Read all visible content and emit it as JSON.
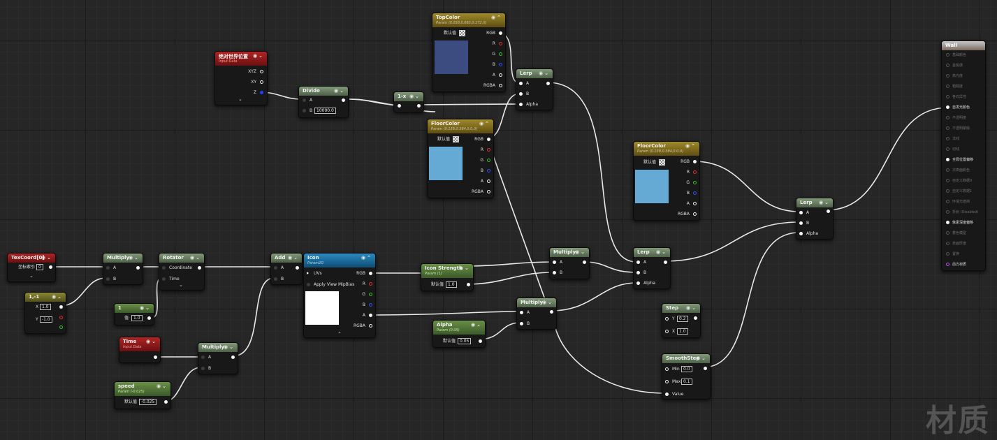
{
  "labels": {
    "default": "默认值",
    "rgb": "RGB",
    "r": "R",
    "g": "G",
    "b": "B",
    "a": "A",
    "rgba": "RGBA",
    "xyz": "XYZ",
    "xy": "XY",
    "z": "Z",
    "alpha": "Alpha",
    "value": "Value",
    "time": "Time",
    "coordinate": "Coordinate",
    "uvs": "UVs",
    "apply_mips": "Apply View MipBias",
    "coord_index": "坐标索引",
    "val": "值",
    "x": "X",
    "y": "Y",
    "min": "Min",
    "max": "Max"
  },
  "nodes": {
    "topcolor": {
      "title": "TopColor",
      "subtitle": "Param (0.038,0.063,0.172,0)"
    },
    "floorcolor1": {
      "title": "FloorColor",
      "subtitle": "Param (0.138,0.384,0.0,0)"
    },
    "floorcolor2": {
      "title": "FloorColor",
      "subtitle": "Param (0.138,0.384,0.0,0)"
    },
    "worldpos": {
      "title": "绝对世界位置",
      "subtitle": "Input Data"
    },
    "divide": {
      "title": "Divide",
      "b_value": "10000.0"
    },
    "oneminus": {
      "title": "1-x"
    },
    "lerp_top": {
      "title": "Lerp"
    },
    "lerp_mid": {
      "title": "Lerp"
    },
    "lerp_right": {
      "title": "Lerp"
    },
    "texcoord": {
      "title": "TexCoord[0]",
      "index_value": "0"
    },
    "vec2": {
      "title": "1,-1",
      "x_value": "1.0",
      "y_value": "-1.0"
    },
    "multiply1": {
      "title": "Multiply"
    },
    "rotator": {
      "title": "Rotator"
    },
    "const1": {
      "title": "1",
      "value": "1.0"
    },
    "add": {
      "title": "Add"
    },
    "time": {
      "title": "Time",
      "subtitle": "Input Data"
    },
    "multiply2": {
      "title": "Multiply"
    },
    "speed": {
      "title": "speed",
      "subtitle": "Param (-0.025)",
      "value": "-0.025"
    },
    "icon": {
      "title": "Icon",
      "subtitle": "Param2D"
    },
    "iconstrength": {
      "title": "Icon Strength",
      "subtitle": "Param (1)",
      "value": "1.0"
    },
    "multiply3": {
      "title": "Multiply"
    },
    "multiply4": {
      "title": "Multiply"
    },
    "alphaparam": {
      "title": "Alpha",
      "subtitle": "Param (0.05)",
      "value": "0.05"
    },
    "step": {
      "title": "Step",
      "y_value": "0.2",
      "x_value": "1.0"
    },
    "smoothstep": {
      "title": "SmoothStep",
      "min_value": "0.0",
      "max_value": "0.1"
    },
    "material": {
      "title": "Wall",
      "pins": [
        "基础颜色",
        "金属感",
        "高光度",
        "粗糙度",
        "各向异性",
        "自发光颜色",
        "不透明度",
        "不透明蒙版",
        "法线",
        "切线",
        "全局位置偏移",
        "次表面颜色",
        "自定义数据0",
        "自定义数据1",
        "环境光遮挡",
        "折射 (Disabled)",
        "像素深度偏移",
        "着色模型",
        "表面厚度",
        "置换",
        "前方材质"
      ]
    }
  },
  "colors": {
    "topcolor_swatch": "#3c4b80",
    "floorcolor_swatch": "#65aad4",
    "icon_swatch": "#ffffff"
  },
  "watermark": "材质"
}
